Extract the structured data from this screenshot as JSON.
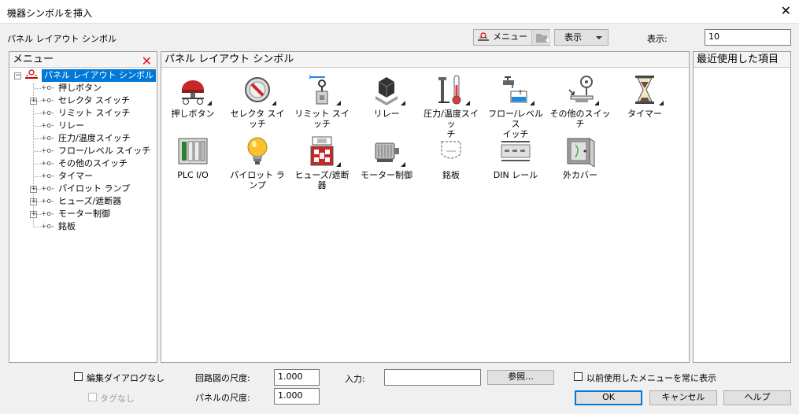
{
  "window": {
    "title": "機器シンボルを挿入",
    "close": "✕"
  },
  "toolbar": {
    "section_label": "パネル レイアウト シンボル",
    "menu_button": "メニュー",
    "display_button": "表示",
    "display_size_label": "表示:",
    "display_size_value": "10"
  },
  "menu_panel": {
    "header": "メニュー",
    "tree": [
      {
        "label": "パネル レイアウト シンボル",
        "level": 0,
        "expander": "−",
        "selected": true
      },
      {
        "label": "押しボタン",
        "level": 1,
        "expander": ""
      },
      {
        "label": "セレクタ スイッチ",
        "level": 1,
        "expander": "+"
      },
      {
        "label": "リミット スイッチ",
        "level": 1,
        "expander": ""
      },
      {
        "label": "リレー",
        "level": 1,
        "expander": ""
      },
      {
        "label": "圧力/温度スイッチ",
        "level": 1,
        "expander": ""
      },
      {
        "label": "フロー/レベル スイッチ",
        "level": 1,
        "expander": ""
      },
      {
        "label": "その他のスイッチ",
        "level": 1,
        "expander": ""
      },
      {
        "label": "タイマー",
        "level": 1,
        "expander": ""
      },
      {
        "label": "パイロット ランプ",
        "level": 1,
        "expander": "+"
      },
      {
        "label": "ヒューズ/遮断器",
        "level": 1,
        "expander": "+"
      },
      {
        "label": "モーター制御",
        "level": 1,
        "expander": "+"
      },
      {
        "label": "銘板",
        "level": 1,
        "expander": ""
      }
    ]
  },
  "symbols_panel": {
    "header": "パネル レイアウト シンボル",
    "items": [
      {
        "label": "押しボタン",
        "icon": "push-button-icon"
      },
      {
        "label": "セレクタ スイッチ",
        "icon": "selector-switch-icon"
      },
      {
        "label": "リミット スイッチ",
        "icon": "limit-switch-icon"
      },
      {
        "label": "リレー",
        "icon": "relay-icon"
      },
      {
        "label": "圧力/温度スイッ\nチ",
        "icon": "pressure-temperature-switch-icon"
      },
      {
        "label": "フロー/レベル ス\nイッチ",
        "icon": "flow-level-switch-icon"
      },
      {
        "label": "その他のスイッチ",
        "icon": "other-switch-icon"
      },
      {
        "label": "タイマー",
        "icon": "timer-icon"
      },
      {
        "label": "PLC I/O",
        "icon": "plc-io-icon"
      },
      {
        "label": "パイロット ランプ",
        "icon": "pilot-lamp-icon"
      },
      {
        "label": "ヒューズ/遮断器",
        "icon": "fuse-breaker-icon"
      },
      {
        "label": "モーター制御",
        "icon": "motor-control-icon"
      },
      {
        "label": "銘板",
        "icon": "nameplate-icon"
      },
      {
        "label": "DIN レール",
        "icon": "din-rail-icon"
      },
      {
        "label": "外カバー",
        "icon": "enclosure-icon"
      }
    ]
  },
  "recent_panel": {
    "header": "最近使用した項目"
  },
  "footer": {
    "no_edit_dialog": "編集ダイアログなし",
    "no_tag": "タグなし",
    "schematic_scale_label": "回路図の尺度:",
    "schematic_scale_value": "1.000",
    "panel_scale_label": "パネルの尺度:",
    "panel_scale_value": "1.000",
    "input_label": "入力:",
    "input_value": "",
    "browse_button": "参照...",
    "always_show_prev_menu": "以前使用したメニューを常に表示",
    "ok_button": "OK",
    "cancel_button": "キャンセル",
    "help_button": "ヘルプ"
  },
  "colors": {
    "selection": "#0078d7",
    "close_red": "#e81123"
  }
}
